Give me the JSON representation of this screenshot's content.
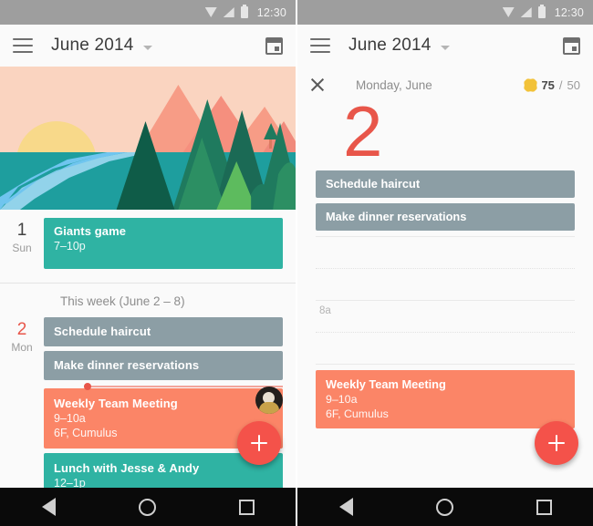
{
  "status_bar": {
    "time": "12:30",
    "icons": [
      "wifi-icon",
      "signal-icon",
      "battery-icon"
    ],
    "background": "#9e9e9e"
  },
  "app_bar": {
    "menu_icon": "hamburger-menu-icon",
    "title": "June 2014",
    "dropdown_icon": "caret-down-icon",
    "action_icon": "calendar-today-icon"
  },
  "colors": {
    "accent_red": "#f4524a",
    "today_red": "#e8564a",
    "teal_event": "#2fb3a3",
    "slate_task": "#8c9ea5",
    "salmon_event": "#fb8567",
    "sky": "#fad4c0",
    "sun": "#f8d98a",
    "water": "#1e9e9e",
    "river": "#6fc5ef",
    "pine": "#0f5c48",
    "mountain": "#f79c86"
  },
  "left_panel": {
    "hero": {
      "name": "june-landscape-illustration",
      "alt": "Stylized sunrise over a lake with pine forest and pink mountains"
    },
    "days": [
      {
        "number": "1",
        "weekday": "Sun",
        "is_today": false,
        "events": [
          {
            "title": "Giants game",
            "subtitle": "7–10p",
            "color": "#2fb3a3",
            "type": "event"
          }
        ]
      },
      {
        "number": "2",
        "weekday": "Mon",
        "is_today": true,
        "events": [
          {
            "title": "Schedule haircut",
            "subtitle": "",
            "color": "#8c9ea5",
            "type": "task"
          },
          {
            "title": "Make dinner reservations",
            "subtitle": "",
            "color": "#8c9ea5",
            "type": "task"
          },
          {
            "title": "Weekly Team Meeting",
            "subtitle": "9–10a",
            "subtitle2": "6F, Cumulus",
            "color": "#fb8567",
            "type": "event"
          },
          {
            "title": "Lunch with Jesse & Andy",
            "subtitle": "12–1p",
            "color": "#2fb3a3",
            "type": "event"
          }
        ]
      }
    ],
    "week_label": "This week (June 2 – 8)",
    "now_indicator": "current-time-line",
    "fab_label": "+",
    "avatar_label": "attendee-avatar"
  },
  "right_panel": {
    "close_label": "×",
    "date_label": "Monday, June",
    "goal": {
      "icon": "goal-star-icon",
      "current": "75",
      "separator": "/",
      "target": "50"
    },
    "day_number": "2",
    "tasks": [
      {
        "title": "Schedule haircut",
        "color": "#8c9ea5"
      },
      {
        "title": "Make dinner reservations",
        "color": "#8c9ea5"
      }
    ],
    "hour_labels": [
      "8a"
    ],
    "events": [
      {
        "title": "Weekly Team Meeting",
        "subtitle": "9–10a",
        "subtitle2": "6F, Cumulus",
        "color": "#fb8567"
      }
    ],
    "fab_label": "+"
  },
  "nav_bar": {
    "back": "back-triangle-icon",
    "home": "home-circle-icon",
    "recents": "recents-square-icon"
  }
}
